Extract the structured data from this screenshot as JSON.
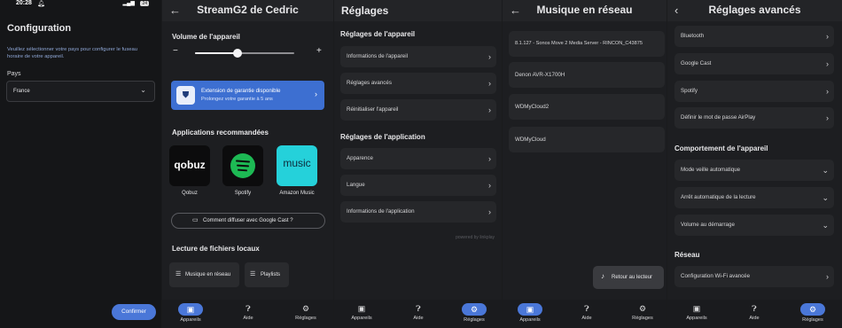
{
  "status": {
    "time": "20:28",
    "battery": "24"
  },
  "p1": {
    "title": "Configuration",
    "desc": "Veuillez sélectionner votre pays pour configurer le fuseau horaire de votre appareil.",
    "country_label": "Pays",
    "country_value": "France",
    "confirm": "Confirmer"
  },
  "p2": {
    "title": "StreamG2 de Cedric",
    "volume_label": "Volume de l'appareil",
    "volume_level": 0.42,
    "warranty_title": "Extension de garantie disponible",
    "warranty_sub": "Prolongez votre garantie à 5 ans",
    "apps_title": "Applications recommandées",
    "apps": [
      {
        "name": "Qobuz",
        "logo": "qobuz"
      },
      {
        "name": "Spotify",
        "logo": "spotify-icon"
      },
      {
        "name": "Amazon Music",
        "logo": "music"
      }
    ],
    "cast_button": "Comment diffuser avec Google Cast ?",
    "local_title": "Lecture de fichiers locaux",
    "local_buttons": [
      "Musique en réseau",
      "Playlists"
    ]
  },
  "p3": {
    "title": "Réglages",
    "device_section": "Réglages de l'appareil",
    "device_items": [
      "Informations de l'appareil",
      "Réglages avancés",
      "Réinitialiser l'appareil"
    ],
    "app_section": "Réglages de l'application",
    "app_items": [
      "Apparence",
      "Langue",
      "Informations de l'application"
    ],
    "powered": "powered by linkplay"
  },
  "p4": {
    "title": "Musique en réseau",
    "servers": [
      "8.1.127 - Sonos Move 2 Media Server - RINCON_C43875",
      "Denon AVR-X1700H",
      "WDMyCloud2",
      "WDMyCloud"
    ],
    "back_to_player": "Retour au lecteur"
  },
  "p5": {
    "title": "Réglages avancés",
    "top_items": [
      "Bluetooth",
      "Google Cast",
      "Spotify",
      "Définir le mot de passe AirPlay"
    ],
    "behavior_section": "Comportement de l'appareil",
    "behavior_items": [
      "Mode veille automatique",
      "Arrêt automatique de la lecture",
      "Volume au démarrage"
    ],
    "network_section": "Réseau",
    "network_items": [
      "Configuration Wi-Fi avancée"
    ]
  },
  "nav": {
    "devices": "Appareils",
    "help": "Aide",
    "settings": "Réglages"
  },
  "colors": {
    "accent": "#4a77d8",
    "warranty_bg": "#3d6fd1",
    "spotify": "#1db954",
    "amazon": "#25d1da"
  }
}
